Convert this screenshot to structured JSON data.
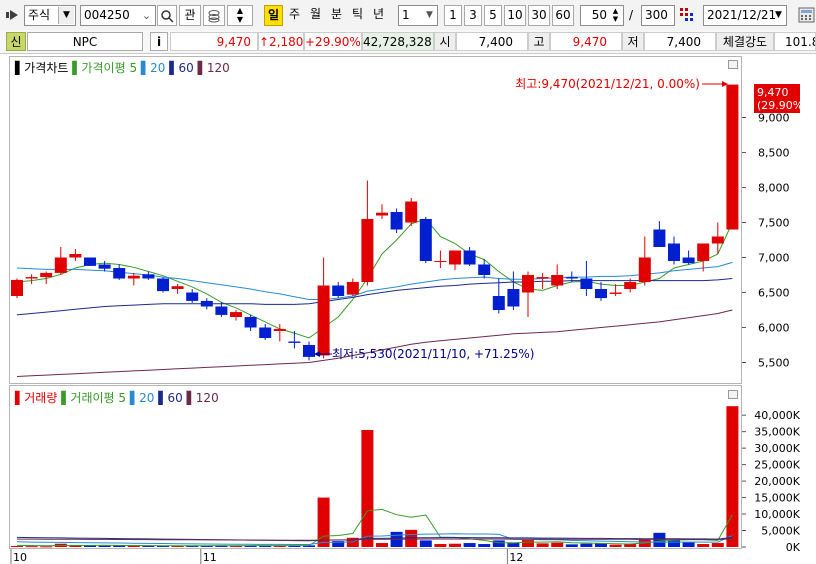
{
  "toolbar": {
    "market": "주식",
    "code": "004250",
    "btn_watch": "관",
    "periods": [
      "일",
      "주",
      "월",
      "분",
      "틱",
      "년"
    ],
    "active_period": "일",
    "interval_value": "1",
    "quick": [
      "1",
      "3",
      "5",
      "10",
      "30",
      "60"
    ],
    "count": "50",
    "total": "300",
    "date": "2021/12/21"
  },
  "quote": {
    "badge": "신",
    "name": "NPC",
    "info": "i",
    "price": "9,470",
    "change": "↑2,180",
    "change_pct": "+29.90%",
    "volume": "42,728,328",
    "open_label": "시",
    "open": "7,400",
    "high_label": "고",
    "high": "9,470",
    "low_label": "저",
    "low": "7,400",
    "strength_label": "체결강도",
    "strength": "101.8"
  },
  "price_panel": {
    "legend": [
      {
        "text": "가격차트",
        "color": "#000000"
      },
      {
        "text": "가격이평 5",
        "color": "#3a9a2a"
      },
      {
        "text": "20",
        "color": "#2a8ad0"
      },
      {
        "text": "60",
        "color": "#1a2a8a"
      },
      {
        "text": "120",
        "color": "#6a2a4a"
      }
    ],
    "max_label": "최고:9,470(2021/12/21, 0.00%)",
    "min_label": "최저:5,530(2021/11/10, +71.25%)",
    "current_price": "9,470",
    "current_pct": "(29.90%)"
  },
  "volume_panel": {
    "legend": [
      {
        "text": "거래량",
        "color": "#e00000"
      },
      {
        "text": "거래이평 5",
        "color": "#3a9a2a"
      },
      {
        "text": "20",
        "color": "#2a8ad0"
      },
      {
        "text": "60",
        "color": "#1a2a8a"
      },
      {
        "text": "120",
        "color": "#6a2a4a"
      }
    ]
  },
  "chart_data": {
    "type": "candlestick",
    "price_axis_ticks": [
      5500,
      6000,
      6500,
      7000,
      7500,
      8000,
      8500,
      9000
    ],
    "price_axis_labels": [
      "5,500",
      "6,000",
      "6,500",
      "7,000",
      "7,500",
      "8,000",
      "8,500",
      "9,000"
    ],
    "price_range": [
      5250,
      9650
    ],
    "volume_axis_ticks": [
      0,
      5000,
      10000,
      15000,
      20000,
      25000,
      30000,
      35000,
      40000
    ],
    "volume_axis_labels": [
      "0K",
      "5,000K",
      "10,000K",
      "15,000K",
      "20,000K",
      "25,000K",
      "30,000K",
      "35,000K",
      "40,000K"
    ],
    "volume_range": [
      0,
      44000
    ],
    "x_labels": [
      {
        "index": 0,
        "text": "10"
      },
      {
        "index": 13,
        "text": "11"
      },
      {
        "index": 34,
        "text": "12"
      }
    ],
    "candles": [
      {
        "o": 6450,
        "h": 6700,
        "l": 6420,
        "c": 6680,
        "v": 300
      },
      {
        "o": 6700,
        "h": 6760,
        "l": 6620,
        "c": 6720,
        "v": 250
      },
      {
        "o": 6720,
        "h": 6800,
        "l": 6620,
        "c": 6780,
        "v": 200
      },
      {
        "o": 6780,
        "h": 7150,
        "l": 6750,
        "c": 7000,
        "v": 1000
      },
      {
        "o": 7000,
        "h": 7120,
        "l": 6950,
        "c": 7050,
        "v": 600
      },
      {
        "o": 7000,
        "h": 7000,
        "l": 6880,
        "c": 6880,
        "v": 500
      },
      {
        "o": 6900,
        "h": 6950,
        "l": 6800,
        "c": 6840,
        "v": 400
      },
      {
        "o": 6850,
        "h": 6900,
        "l": 6680,
        "c": 6700,
        "v": 500
      },
      {
        "o": 6700,
        "h": 6780,
        "l": 6600,
        "c": 6740,
        "v": 400
      },
      {
        "o": 6760,
        "h": 6800,
        "l": 6680,
        "c": 6700,
        "v": 350
      },
      {
        "o": 6700,
        "h": 6720,
        "l": 6500,
        "c": 6520,
        "v": 400
      },
      {
        "o": 6550,
        "h": 6620,
        "l": 6480,
        "c": 6590,
        "v": 300
      },
      {
        "o": 6500,
        "h": 6550,
        "l": 6350,
        "c": 6380,
        "v": 450
      },
      {
        "o": 6380,
        "h": 6420,
        "l": 6260,
        "c": 6300,
        "v": 400
      },
      {
        "o": 6300,
        "h": 6360,
        "l": 6150,
        "c": 6180,
        "v": 500
      },
      {
        "o": 6150,
        "h": 6250,
        "l": 6100,
        "c": 6220,
        "v": 350
      },
      {
        "o": 6150,
        "h": 6180,
        "l": 5950,
        "c": 6000,
        "v": 450
      },
      {
        "o": 6000,
        "h": 6050,
        "l": 5820,
        "c": 5850,
        "v": 400
      },
      {
        "o": 5950,
        "h": 6050,
        "l": 5800,
        "c": 5980,
        "v": 350
      },
      {
        "o": 5800,
        "h": 5950,
        "l": 5700,
        "c": 5780,
        "v": 450
      },
      {
        "o": 5750,
        "h": 5800,
        "l": 5530,
        "c": 5580,
        "v": 500
      },
      {
        "o": 5600,
        "h": 7000,
        "l": 5560,
        "c": 6600,
        "v": 15000
      },
      {
        "o": 6600,
        "h": 6650,
        "l": 6420,
        "c": 6450,
        "v": 1800
      },
      {
        "o": 6470,
        "h": 6700,
        "l": 6450,
        "c": 6650,
        "v": 2800
      },
      {
        "o": 6650,
        "h": 8100,
        "l": 6600,
        "c": 7550,
        "v": 35500
      },
      {
        "o": 7600,
        "h": 7760,
        "l": 7550,
        "c": 7640,
        "v": 1200
      },
      {
        "o": 7650,
        "h": 7700,
        "l": 7350,
        "c": 7400,
        "v": 4600
      },
      {
        "o": 7500,
        "h": 7850,
        "l": 7450,
        "c": 7800,
        "v": 5200
      },
      {
        "o": 7550,
        "h": 7580,
        "l": 6920,
        "c": 6950,
        "v": 2000
      },
      {
        "o": 6950,
        "h": 7100,
        "l": 6850,
        "c": 6950,
        "v": 900
      },
      {
        "o": 6900,
        "h": 7100,
        "l": 6820,
        "c": 7100,
        "v": 1000
      },
      {
        "o": 7100,
        "h": 7150,
        "l": 6880,
        "c": 6900,
        "v": 1200
      },
      {
        "o": 6900,
        "h": 6980,
        "l": 6700,
        "c": 6750,
        "v": 900
      },
      {
        "o": 6450,
        "h": 6700,
        "l": 6200,
        "c": 6250,
        "v": 2000
      },
      {
        "o": 6550,
        "h": 6800,
        "l": 6250,
        "c": 6300,
        "v": 1400
      },
      {
        "o": 6500,
        "h": 6800,
        "l": 6150,
        "c": 6750,
        "v": 2100
      },
      {
        "o": 6700,
        "h": 6780,
        "l": 6550,
        "c": 6720,
        "v": 1100
      },
      {
        "o": 6600,
        "h": 6900,
        "l": 6550,
        "c": 6750,
        "v": 1300
      },
      {
        "o": 6720,
        "h": 6800,
        "l": 6650,
        "c": 6700,
        "v": 800
      },
      {
        "o": 6700,
        "h": 6950,
        "l": 6450,
        "c": 6550,
        "v": 1000
      },
      {
        "o": 6550,
        "h": 6650,
        "l": 6380,
        "c": 6420,
        "v": 1100
      },
      {
        "o": 6480,
        "h": 6620,
        "l": 6450,
        "c": 6500,
        "v": 700
      },
      {
        "o": 6550,
        "h": 6700,
        "l": 6500,
        "c": 6650,
        "v": 900
      },
      {
        "o": 6650,
        "h": 7300,
        "l": 6600,
        "c": 7000,
        "v": 2200
      },
      {
        "o": 7400,
        "h": 7520,
        "l": 7150,
        "c": 7150,
        "v": 4300
      },
      {
        "o": 7200,
        "h": 7300,
        "l": 6900,
        "c": 6950,
        "v": 2100
      },
      {
        "o": 7000,
        "h": 7100,
        "l": 6900,
        "c": 6920,
        "v": 1500
      },
      {
        "o": 6950,
        "h": 7200,
        "l": 6800,
        "c": 7200,
        "v": 900
      },
      {
        "o": 7200,
        "h": 7500,
        "l": 7050,
        "c": 7300,
        "v": 1200
      },
      {
        "o": 7400,
        "h": 9470,
        "l": 7400,
        "c": 9470,
        "v": 42728
      }
    ],
    "price_ma": [
      {
        "name": "5",
        "color": "#3a9a2a",
        "values": [
          6650,
          6670,
          6700,
          6760,
          6850,
          6900,
          6920,
          6900,
          6860,
          6800,
          6740,
          6660,
          6580,
          6480,
          6360,
          6280,
          6180,
          6080,
          5980,
          5920,
          5850,
          6000,
          6150,
          6400,
          6700,
          7050,
          7250,
          7480,
          7550,
          7300,
          7200,
          7050,
          6970,
          6800,
          6650,
          6550,
          6530,
          6600,
          6650,
          6660,
          6620,
          6600,
          6600,
          6650,
          6700,
          6850,
          6900,
          6950,
          7050,
          7500
        ]
      },
      {
        "name": "20",
        "color": "#2a8ad0",
        "values": [
          6850,
          6840,
          6830,
          6830,
          6830,
          6820,
          6810,
          6790,
          6770,
          6750,
          6720,
          6700,
          6670,
          6640,
          6610,
          6580,
          6550,
          6510,
          6480,
          6440,
          6400,
          6400,
          6420,
          6450,
          6520,
          6550,
          6580,
          6620,
          6650,
          6680,
          6700,
          6710,
          6720,
          6700,
          6690,
          6690,
          6700,
          6710,
          6720,
          6720,
          6730,
          6730,
          6740,
          6760,
          6780,
          6810,
          6830,
          6850,
          6870,
          6930
        ]
      },
      {
        "name": "60",
        "color": "#1a2a8a",
        "values": [
          6180,
          6200,
          6220,
          6240,
          6260,
          6280,
          6300,
          6310,
          6320,
          6330,
          6340,
          6340,
          6340,
          6340,
          6340,
          6340,
          6340,
          6330,
          6330,
          6330,
          6340,
          6370,
          6400,
          6430,
          6470,
          6500,
          6530,
          6550,
          6570,
          6590,
          6600,
          6620,
          6630,
          6640,
          6650,
          6650,
          6660,
          6660,
          6670,
          6670,
          6670,
          6670,
          6670,
          6670,
          6670,
          6670,
          6670,
          6670,
          6680,
          6700
        ]
      },
      {
        "name": "120",
        "color": "#6a2a4a",
        "values": [
          5300,
          5310,
          5320,
          5330,
          5340,
          5350,
          5360,
          5370,
          5380,
          5390,
          5400,
          5410,
          5420,
          5430,
          5440,
          5450,
          5460,
          5470,
          5480,
          5490,
          5500,
          5530,
          5560,
          5600,
          5640,
          5680,
          5720,
          5760,
          5790,
          5810,
          5830,
          5850,
          5870,
          5890,
          5910,
          5920,
          5930,
          5940,
          5960,
          5980,
          6000,
          6020,
          6040,
          6060,
          6080,
          6110,
          6140,
          6170,
          6200,
          6250
        ]
      }
    ],
    "volume_ma": [
      {
        "name": "5",
        "color": "#3a9a2a",
        "values": [
          500,
          450,
          400,
          450,
          480,
          500,
          520,
          500,
          450,
          430,
          400,
          380,
          360,
          360,
          380,
          400,
          420,
          420,
          420,
          430,
          450,
          3300,
          3500,
          4100,
          11000,
          11400,
          9800,
          9000,
          9700,
          3000,
          2900,
          2500,
          2000,
          1300,
          1200,
          1500,
          1500,
          1600,
          1300,
          1200,
          1100,
          1000,
          900,
          1200,
          1800,
          2100,
          2200,
          2200,
          2000,
          9800
        ]
      },
      {
        "name": "20",
        "color": "#2a8ad0",
        "values": [
          1600,
          1500,
          1450,
          1400,
          1350,
          1300,
          1250,
          1200,
          1150,
          1100,
          1050,
          1000,
          950,
          900,
          870,
          850,
          830,
          800,
          780,
          760,
          750,
          1400,
          1450,
          1550,
          3300,
          3350,
          3550,
          3800,
          3900,
          3950,
          4000,
          3950,
          3950,
          3850,
          2300,
          2300,
          2200,
          2200,
          2000,
          1900,
          1800,
          1700,
          1600,
          1500,
          1500,
          1500,
          1500,
          1500,
          1500,
          3500
        ]
      },
      {
        "name": "60",
        "color": "#1a2a8a",
        "values": [
          2900,
          2850,
          2800,
          2750,
          2700,
          2650,
          2600,
          2550,
          2500,
          2450,
          2400,
          2350,
          2300,
          2250,
          2200,
          2150,
          2100,
          2050,
          2000,
          1950,
          1900,
          2100,
          2150,
          2200,
          2600,
          2600,
          2700,
          2800,
          2800,
          2850,
          2850,
          2850,
          2800,
          2800,
          2750,
          2750,
          2700,
          2700,
          2650,
          2600,
          2600,
          2550,
          2550,
          2500,
          2500,
          2500,
          2450,
          2450,
          2400,
          2900
        ]
      },
      {
        "name": "120",
        "color": "#6a2a4a",
        "values": [
          2400,
          2400,
          2380,
          2360,
          2340,
          2320,
          2300,
          2280,
          2260,
          2240,
          2220,
          2200,
          2180,
          2160,
          2140,
          2120,
          2100,
          2080,
          2060,
          2040,
          2020,
          2100,
          2120,
          2150,
          2350,
          2360,
          2380,
          2400,
          2420,
          2430,
          2440,
          2440,
          2430,
          2420,
          2410,
          2400,
          2390,
          2380,
          2370,
          2360,
          2350,
          2340,
          2330,
          2320,
          2310,
          2300,
          2290,
          2280,
          2270,
          2500
        ]
      }
    ]
  }
}
